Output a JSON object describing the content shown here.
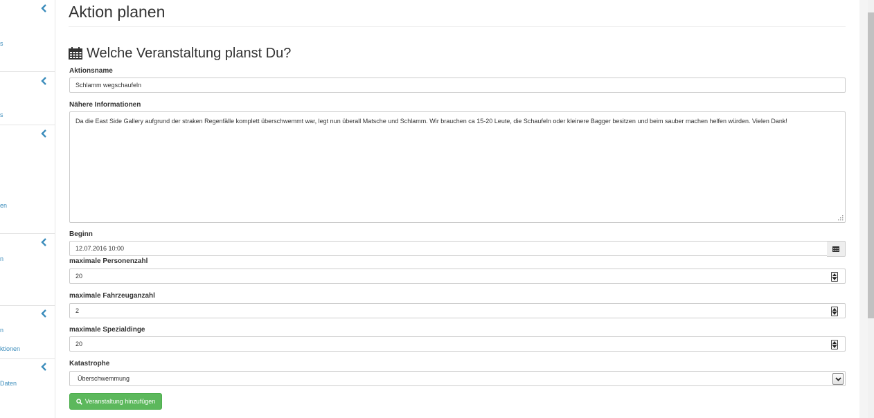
{
  "sidebar": {
    "links": [
      {
        "text": "s"
      },
      {
        "text": "s"
      },
      {
        "text": "en"
      },
      {
        "text": "n"
      },
      {
        "text": "n"
      },
      {
        "text": "ktionen"
      },
      {
        "text": "Daten"
      }
    ]
  },
  "page": {
    "title": "Aktion planen",
    "section_title": "Welche Veranstaltung planst Du?"
  },
  "form": {
    "name_label": "Aktionsname",
    "name_value": "Schlamm wegschaufeln",
    "info_label": "Nähere Informationen",
    "info_value": "Da die East Side Gallery aufgrund der straken Regenfälle komplett überschwemmt war, legt nun überall Matsche und Schlamm. Wir brauchen ca 15-20 Leute, die Schaufeln oder kleinere Bagger besitzen und beim sauber machen helfen würden. Vielen Dank!",
    "begin_label": "Beginn",
    "begin_value": "12.07.2016 10:00",
    "persons_label": "maximale Personenzahl",
    "persons_value": "20",
    "vehicles_label": "maximale Fahrzeuganzahl",
    "vehicles_value": "2",
    "special_label": "maximale Spezialdinge",
    "special_value": "20",
    "catastrophe_label": "Katastrophe",
    "catastrophe_value": "Überschwemmung",
    "submit_label": "Veranstaltung hinzufügen"
  },
  "colors": {
    "link": "#3c8dbc",
    "submit_bg": "#5cb85c"
  }
}
